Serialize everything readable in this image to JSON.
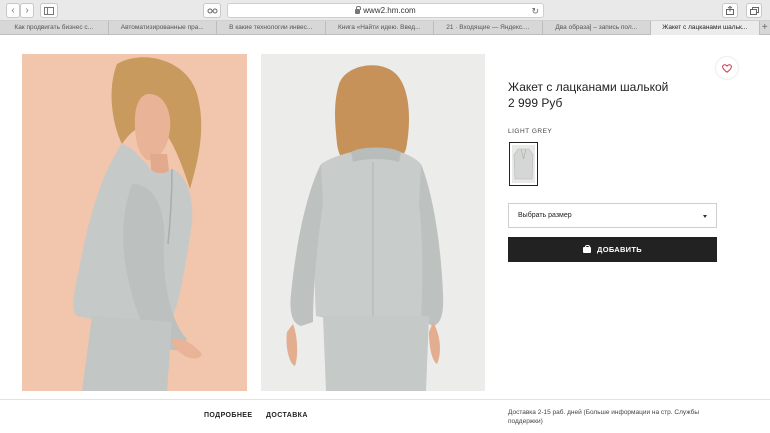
{
  "browser": {
    "url": "www2.hm.com",
    "tabs": [
      "Как продвигать бизнес с...",
      "Автоматизированные пра...",
      "В какие технологии инвес...",
      "Книга «Найти идею. Введ...",
      "21 · Входящие — Яндекс....",
      "Два образа] – запись пол...",
      "Жакет с лацканами шальк..."
    ],
    "active_tab_index": 6
  },
  "product": {
    "title": "Жакет с лацканами шалькой",
    "price": "2 999 Руб",
    "color_name": "LIGHT GREY",
    "size_placeholder": "Выбрать размер",
    "add_button": "ДОБАВИТЬ"
  },
  "footer": {
    "details_link": "ПОДРОБНЕЕ",
    "delivery_link": "ДОСТАВКА",
    "delivery_text": "Доставка 2-15 раб. дней (Больше информации на стр. Службы поддержки)"
  },
  "colors": {
    "button_bg": "#222222",
    "photo1_bg": "#f1c6ad",
    "photo2_bg": "#ececea",
    "wishlist_heart": "#c8324a"
  }
}
